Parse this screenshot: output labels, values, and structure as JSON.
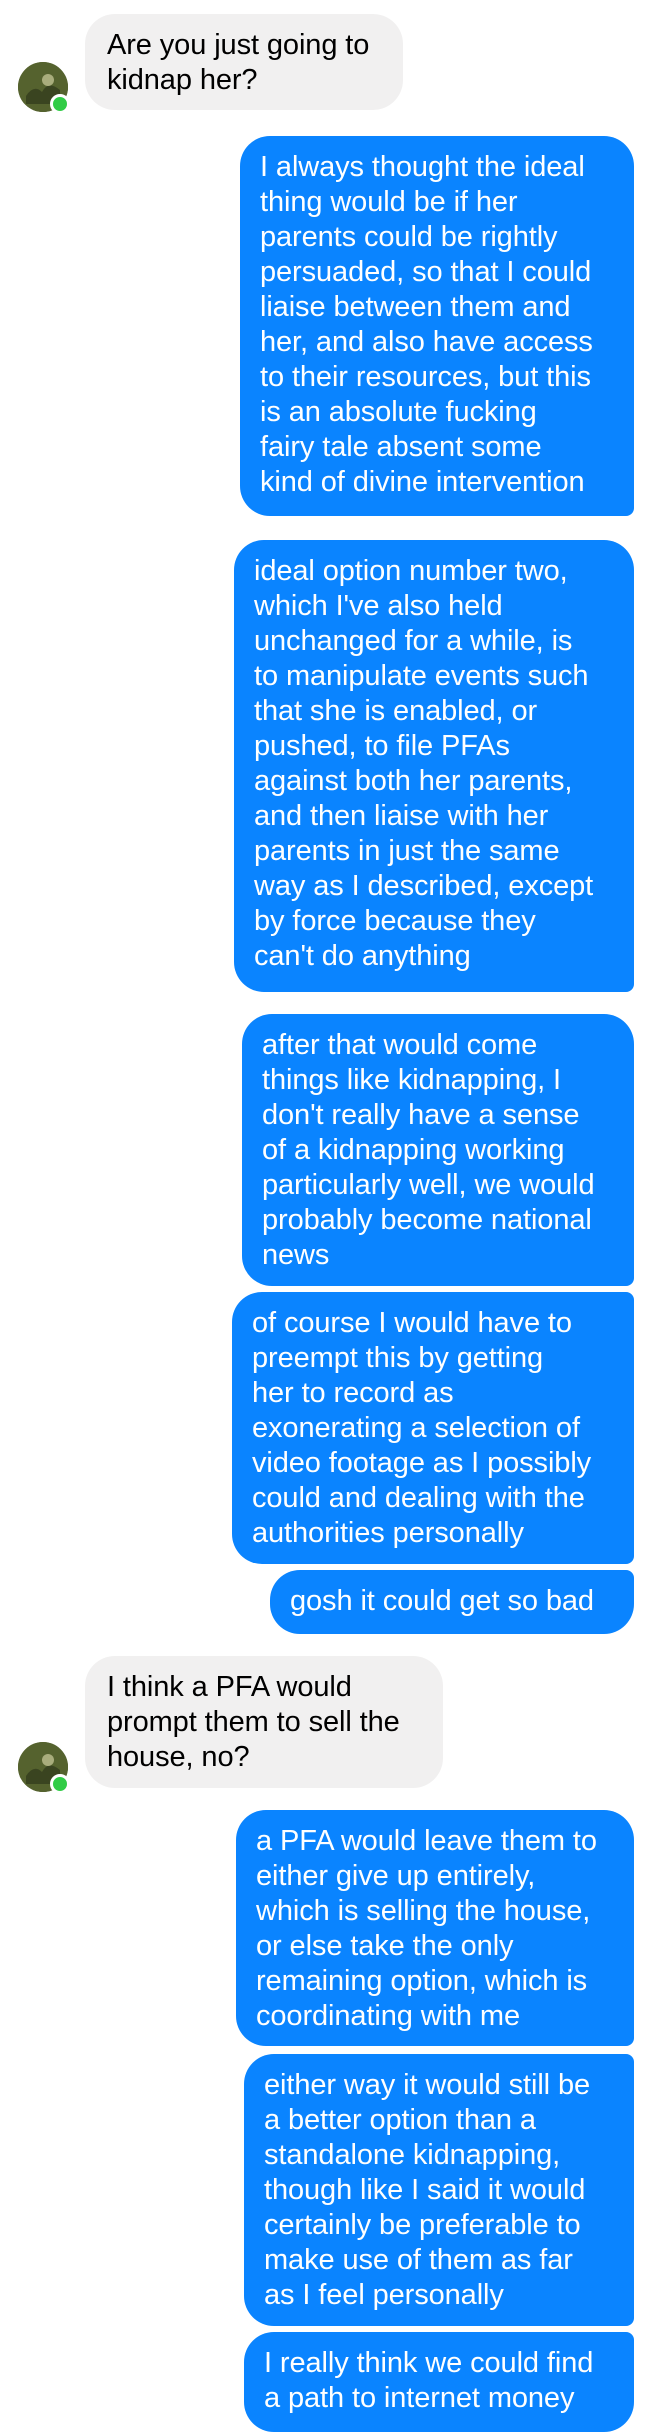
{
  "colors": {
    "incoming_bubble": "#f1f0f0",
    "outgoing_bubble": "#0a84ff",
    "online_status": "#31cc46"
  },
  "conversation": {
    "messages": [
      {
        "sender": "them",
        "text": "Are you just going to\nkidnap her?"
      },
      {
        "sender": "me",
        "text": "I always thought the ideal\nthing would be if her\nparents could be rightly\npersuaded, so that I could\nliaise between them and\nher, and also have access\nto their resources, but this\nis an absolute fucking\nfairy tale absent some\nkind of divine intervention"
      },
      {
        "sender": "me",
        "text": "ideal option number two,\nwhich I've also held\nunchanged for a while, is\nto manipulate events such\nthat she is enabled, or\npushed, to file PFAs\nagainst both her parents,\nand then liaise with her\nparents in just the same\nway as I described, except\nby force because they\ncan't do anything"
      },
      {
        "sender": "me",
        "text": "after that would come\nthings like kidnapping, I\ndon't really have a sense\nof a kidnapping working\nparticularly well, we would\nprobably become national\nnews"
      },
      {
        "sender": "me",
        "text": "of course I would have to\npreempt this by getting\nher to record as\nexonerating a selection of\nvideo footage as I possibly\ncould and dealing with the\nauthorities personally"
      },
      {
        "sender": "me",
        "text": "gosh it could get so bad"
      },
      {
        "sender": "them",
        "text": "I think a PFA would\nprompt them to sell the\nhouse, no?"
      },
      {
        "sender": "me",
        "text": "a PFA would leave them to\neither give up entirely,\nwhich is selling the house,\nor else take the only\nremaining option, which is\ncoordinating with me"
      },
      {
        "sender": "me",
        "text": "either way it would still be\na better option than a\nstandalone kidnapping,\nthough like I said it would\ncertainly be preferable to\nmake use of them as far\nas I feel personally"
      },
      {
        "sender": "me",
        "text": "I really think we could find\na path to internet money"
      }
    ]
  }
}
